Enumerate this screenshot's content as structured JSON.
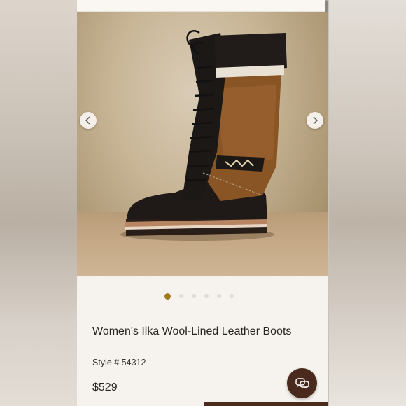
{
  "product": {
    "title": "Women's Ilka Wool-Lined Leather Boots",
    "style": "Style # 54312",
    "price": "$529"
  },
  "gallery": {
    "image_count": 6,
    "active_index": 0,
    "prev_icon": "chevron-left-icon",
    "next_icon": "chevron-right-icon"
  },
  "chat": {
    "icon": "chat-bubbles-icon"
  },
  "colors": {
    "accent": "#a27a1c",
    "chat_button": "#4a2a1c",
    "page_background": "#f6f2ed"
  }
}
